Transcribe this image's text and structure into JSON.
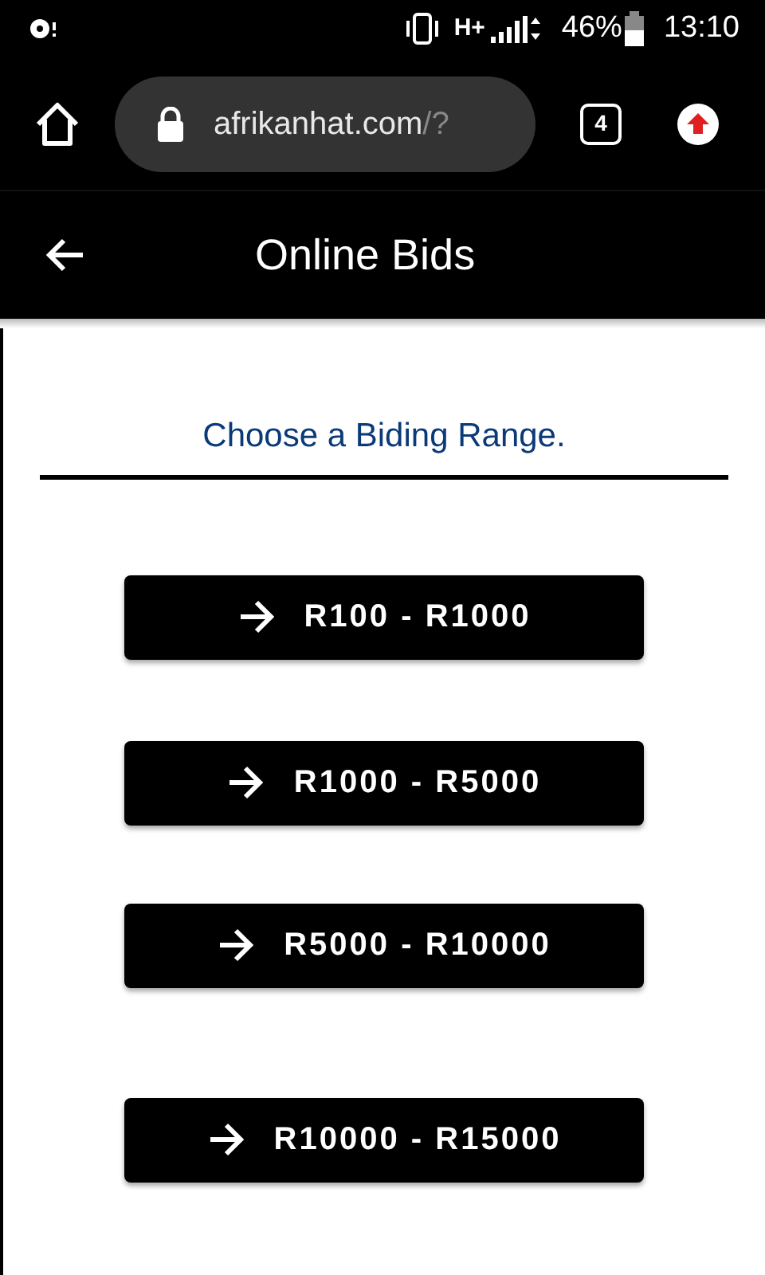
{
  "status_bar": {
    "network": "H+",
    "battery": "46%",
    "time": "13:10"
  },
  "browser": {
    "url_host": "afrikanhat.com",
    "url_path": "/?",
    "tab_count": "4"
  },
  "app_bar": {
    "title": "Online Bids"
  },
  "heading": "Choose a Biding Range.",
  "ranges": [
    {
      "label": "R100 - R1000"
    },
    {
      "label": "R1000 - R5000"
    },
    {
      "label": "R5000 - R10000"
    },
    {
      "label": "R10000 - R15000"
    }
  ]
}
